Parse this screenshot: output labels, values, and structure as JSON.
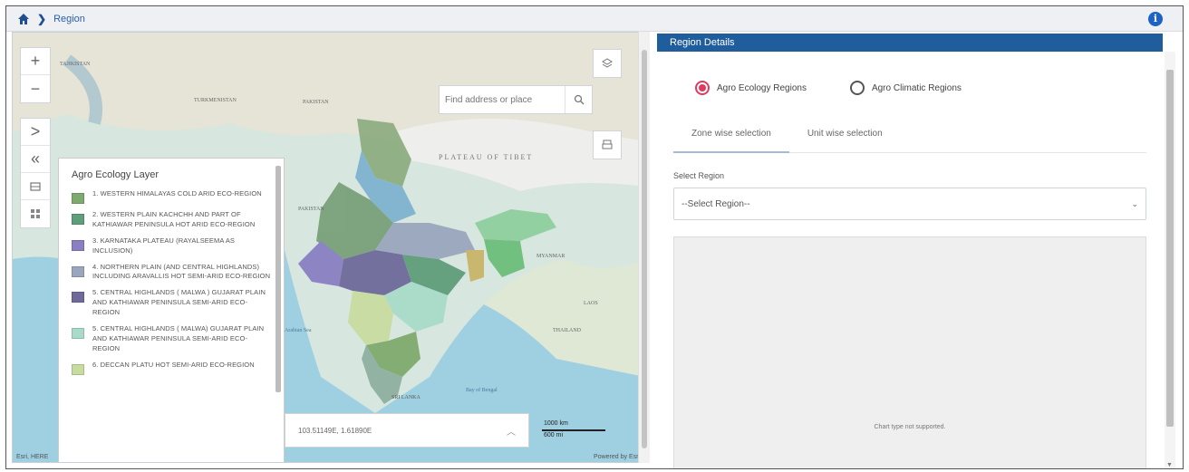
{
  "breadcrumb": {
    "home_icon": "home-icon",
    "separator": "❯",
    "label": "Region"
  },
  "info_icon": "i",
  "map": {
    "zoom_in": "+",
    "zoom_out": "−",
    "expand": ">",
    "collapse": "«",
    "search_placeholder": "Find address or place",
    "coordinates": "103.51149E, 1.61890E",
    "scale_km": "1000 km",
    "scale_mi": "600 mi",
    "attribution_left": "Esri, HERE",
    "attribution_right": "Powered by Esri",
    "labels": {
      "tajikistan": "TAJIKISTAN",
      "turkmenistan": "TURKMENISTAN",
      "pakistan_top": "PAKISTAN",
      "plateau": "PLATEAU OF TIBET",
      "pakistan_left": "PAKISTAN",
      "myanmar": "MYANMAR",
      "laos": "LAOS",
      "thailand": "THAILAND",
      "sri_lanka": "SRI LANKA",
      "bay": "Bay of Bengal",
      "arabian": "Arabian Sea"
    }
  },
  "legend": {
    "title": "Agro Ecology Layer",
    "items": [
      {
        "label": "1. WESTERN HIMALAYAS COLD ARID ECO-REGION",
        "color": "#7faa6e"
      },
      {
        "label": "2. WESTERN PLAIN KACHCHH AND PART OF KATHIAWAR PENINSULA HOT ARID ECO-REGION",
        "color": "#5f9e7a"
      },
      {
        "label": "3. KARNATAKA PLATEAU (RAYALSEEMA AS INCLUSION)",
        "color": "#8a7fc2"
      },
      {
        "label": "4. NORTHERN PLAIN (AND CENTRAL HIGHLANDS) INCLUDING ARAVALLIS HOT SEMI-ARID ECO-REGION",
        "color": "#9aa6bd"
      },
      {
        "label": "5. CENTRAL HIGHLANDS ( MALWA ) GUJARAT PLAIN AND KATHIAWAR PENINSULA SEMI-ARID ECO-REGION",
        "color": "#6f6a9a"
      },
      {
        "label": "5. CENTRAL HIGHLANDS ( MALWA) GUJARAT PLAIN AND KATHIAWAR PENINSULA SEMI-ARID ECO-REGION",
        "color": "#a8dcc8"
      },
      {
        "label": "6. DECCAN PLATU HOT SEMI-ARID ECO-REGION",
        "color": "#c9dca0"
      }
    ]
  },
  "panel": {
    "header": "Region Details",
    "radio_options": [
      {
        "label": "Agro Ecology Regions",
        "selected": true
      },
      {
        "label": "Agro Climatic Regions",
        "selected": false
      }
    ],
    "tabs": [
      "Zone wise selection",
      "Unit wise selection"
    ],
    "select_label": "Select Region",
    "select_value": "--Select Region--",
    "chart_message": "Chart type not supported."
  },
  "colors": {
    "accent": "#1f5d9c",
    "radio": "#e03a5e",
    "info": "#1d63c4"
  }
}
